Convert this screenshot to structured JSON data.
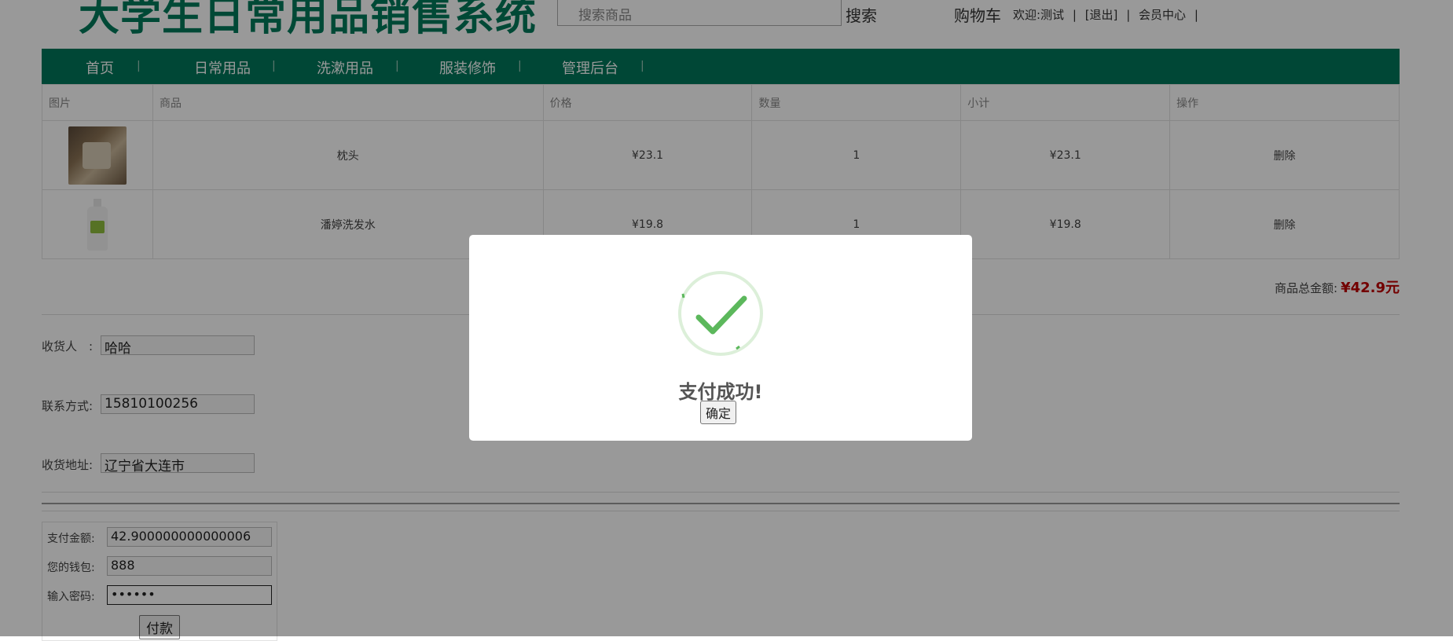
{
  "header": {
    "logo_text": "大学生日常用品销售系统",
    "search_placeholder": "搜索商品",
    "search_label": "搜索",
    "cart_label": "购物车",
    "welcome": "欢迎:测试",
    "logout": "[退出]",
    "member_center": "会员中心",
    "sep": "|"
  },
  "nav": {
    "items": [
      "首页",
      "日常用品",
      "洗漱用品",
      "服装修饰",
      "管理后台"
    ],
    "sep": "|"
  },
  "cart": {
    "headers": [
      "图片",
      "商品",
      "价格",
      "数量",
      "小计",
      "操作"
    ],
    "rows": [
      {
        "name": "枕头",
        "price": "¥23.1",
        "qty": "1",
        "subtotal": "¥23.1",
        "action": "删除"
      },
      {
        "name": "潘婷洗发水",
        "price": "¥19.8",
        "qty": "1",
        "subtotal": "¥19.8",
        "action": "删除"
      }
    ],
    "total_label": "商品总金额:",
    "total_value": "¥42.9元"
  },
  "form": {
    "receiver_label": "收货人　:",
    "receiver_value": "哈哈",
    "contact_label": "联系方式:",
    "contact_value": "15810100256",
    "address_label": "收货地址:",
    "address_value": "辽宁省大连市"
  },
  "payment": {
    "amount_label": "支付金额:",
    "amount_value": "42.900000000000006",
    "wallet_label": "您的钱包:",
    "wallet_value": "888",
    "password_label": "输入密码:",
    "password_value": "••••••",
    "pay_button": "付款"
  },
  "dialog": {
    "title": "支付成功!",
    "ok_button": "确定",
    "icon": "success-check-icon",
    "accent_color": "#5cb85c"
  }
}
